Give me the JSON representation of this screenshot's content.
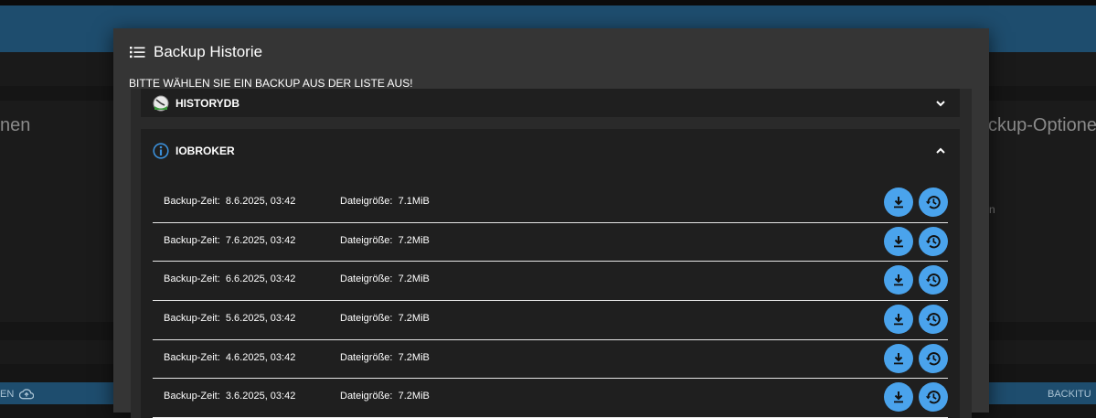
{
  "background": {
    "left_text": "nen",
    "right_text": "ckup-Optione",
    "right_small": "n",
    "footer_left": "EN",
    "footer_right": "BACKITU"
  },
  "dialog": {
    "title": "Backup Historie",
    "title_icon": "list-icon",
    "instruction": "BITTE WÄHLEN SIE EIN BACKUP AUS DER LISTE AUS!"
  },
  "sections": [
    {
      "name": "HISTORYDB",
      "icon": "historydb-clock-icon",
      "expanded": false
    },
    {
      "name": "IOBROKER",
      "icon": "info-icon",
      "expanded": true
    }
  ],
  "backups": [
    {
      "time_label": "Backup-Zeit:",
      "time": "8.6.2025, 03:42",
      "size_label": "Dateigröße:",
      "size": "7.1MiB"
    },
    {
      "time_label": "Backup-Zeit:",
      "time": "7.6.2025, 03:42",
      "size_label": "Dateigröße:",
      "size": "7.2MiB"
    },
    {
      "time_label": "Backup-Zeit:",
      "time": "6.6.2025, 03:42",
      "size_label": "Dateigröße:",
      "size": "7.2MiB"
    },
    {
      "time_label": "Backup-Zeit:",
      "time": "5.6.2025, 03:42",
      "size_label": "Dateigröße:",
      "size": "7.2MiB"
    },
    {
      "time_label": "Backup-Zeit:",
      "time": "4.6.2025, 03:42",
      "size_label": "Dateigröße:",
      "size": "7.2MiB"
    },
    {
      "time_label": "Backup-Zeit:",
      "time": "3.6.2025, 03:42",
      "size_label": "Dateigröße:",
      "size": "7.2MiB"
    }
  ],
  "row_actions": {
    "download_icon": "download-icon",
    "restore_icon": "restore-icon"
  },
  "colors": {
    "accent": "#4aa3ec",
    "header": "#1e4d6e",
    "dialog": "#353535",
    "panel": "#1f1f1f"
  }
}
